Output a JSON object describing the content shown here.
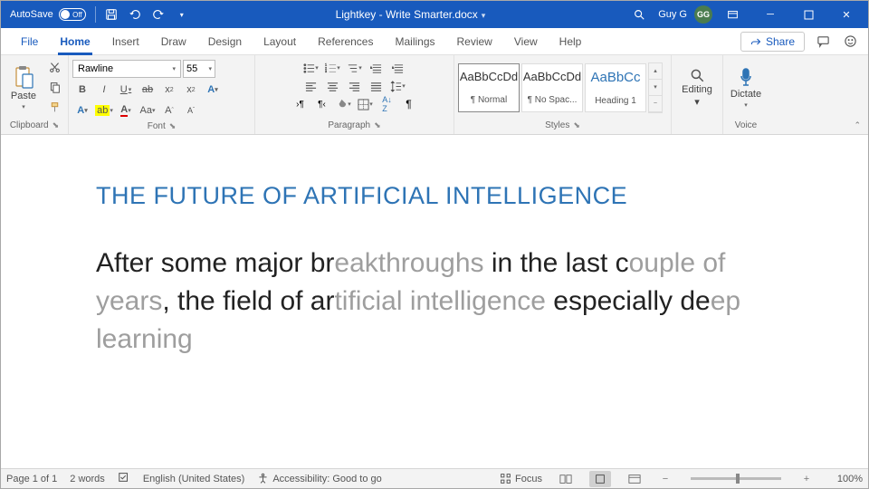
{
  "titlebar": {
    "autosave_label": "AutoSave",
    "autosave_value": "Off",
    "doc_title": "Lightkey - Write Smarter.docx",
    "user_name": "Guy G",
    "user_initials": "GG"
  },
  "tabs": {
    "file": "File",
    "home": "Home",
    "insert": "Insert",
    "draw": "Draw",
    "design": "Design",
    "layout": "Layout",
    "references": "References",
    "mailings": "Mailings",
    "review": "Review",
    "view": "View",
    "help": "Help",
    "share": "Share"
  },
  "ribbon": {
    "clipboard": {
      "label": "Clipboard",
      "paste": "Paste"
    },
    "font": {
      "label": "Font",
      "name": "Rawline",
      "size": "55"
    },
    "paragraph": {
      "label": "Paragraph"
    },
    "styles": {
      "label": "Styles",
      "items": [
        {
          "sample": "AaBbCcDd",
          "name": "¶ Normal"
        },
        {
          "sample": "AaBbCcDd",
          "name": "¶ No Spac..."
        },
        {
          "sample": "AaBbCc",
          "name": "Heading 1"
        }
      ]
    },
    "editing": {
      "label": "Editing"
    },
    "voice": {
      "label": "Voice",
      "dictate": "Dictate"
    }
  },
  "document": {
    "title": "THE FUTURE OF ARTIFICIAL INTELLIGENCE",
    "segments": [
      {
        "t": "After some major br",
        "p": false
      },
      {
        "t": "eakthroughs",
        "p": true
      },
      {
        "t": " in the last c",
        "p": false
      },
      {
        "t": "ouple of years",
        "p": true
      },
      {
        "t": ", the field of ar",
        "p": false
      },
      {
        "t": "tificial intelligence",
        "p": true
      },
      {
        "t": " especially de",
        "p": false
      },
      {
        "t": "ep learning",
        "p": true
      }
    ]
  },
  "status": {
    "page": "Page 1 of 1",
    "words": "2 words",
    "language": "English (United States)",
    "accessibility": "Accessibility: Good to go",
    "focus": "Focus",
    "zoom": "100%"
  }
}
